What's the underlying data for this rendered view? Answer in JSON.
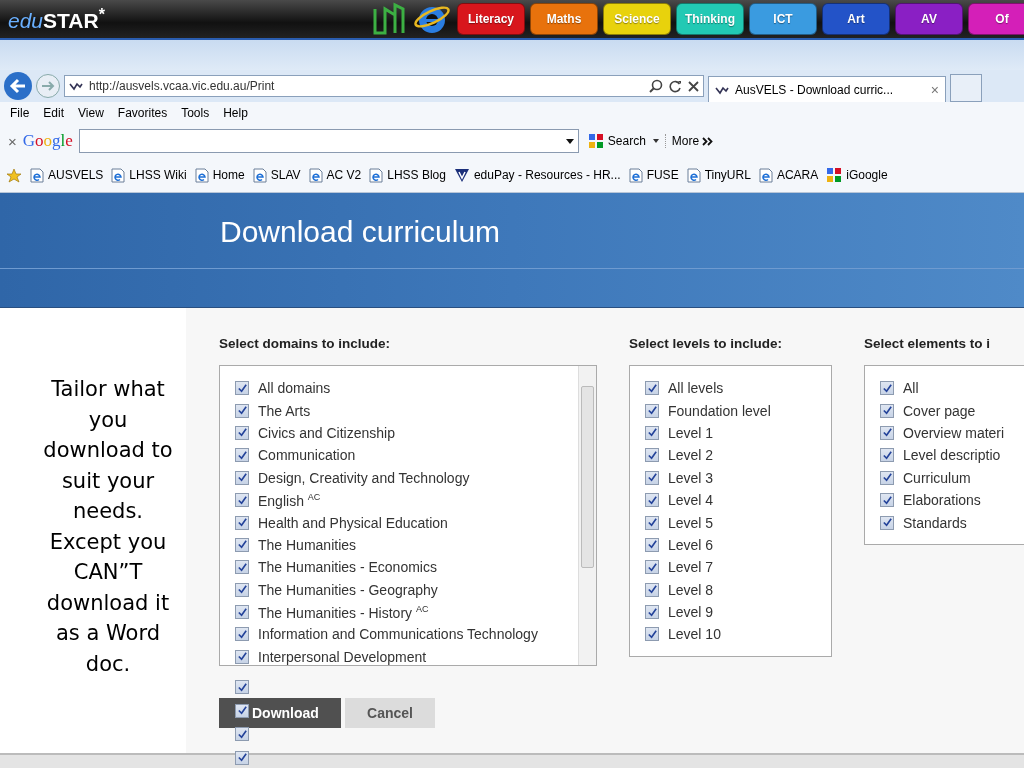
{
  "portal": {
    "logo": "eduSTAR",
    "logo_mark": "*",
    "tabs": [
      {
        "label": "Literacy",
        "color": "#d8161c"
      },
      {
        "label": "Maths",
        "color": "#e8720c"
      },
      {
        "label": "Science",
        "color": "#e8d20c"
      },
      {
        "label": "Thinking",
        "color": "#22c9b4"
      },
      {
        "label": "ICT",
        "color": "#3a9be0"
      },
      {
        "label": "Art",
        "color": "#2353c8"
      },
      {
        "label": "AV",
        "color": "#8a1fc4"
      },
      {
        "label": "Of",
        "color": "#d41fb8"
      }
    ]
  },
  "browser": {
    "address": "http://ausvels.vcaa.vic.edu.au/Print",
    "tab_title": "AusVELS - Download curric...",
    "tab_close": "×",
    "menu": [
      "File",
      "Edit",
      "View",
      "Favorites",
      "Tools",
      "Help"
    ],
    "google_toolbar": {
      "close": "×",
      "logo": "Google",
      "search": "Search",
      "more": "More"
    },
    "favorites": [
      {
        "label": "AUSVELS",
        "kind": "page"
      },
      {
        "label": "LHSS Wiki",
        "kind": "page"
      },
      {
        "label": "Home",
        "kind": "page"
      },
      {
        "label": "SLAV",
        "kind": "page"
      },
      {
        "label": "AC V2",
        "kind": "page"
      },
      {
        "label": "LHSS Blog",
        "kind": "page"
      },
      {
        "label": "eduPay - Resources - HR...",
        "kind": "shield"
      },
      {
        "label": "FUSE",
        "kind": "page"
      },
      {
        "label": "TinyURL",
        "kind": "page"
      },
      {
        "label": "ACARA",
        "kind": "page"
      },
      {
        "label": "iGoogle",
        "kind": "tiles"
      }
    ]
  },
  "page": {
    "title": "Download curriculum",
    "caption": "Tailor what you download to suit your needs. Except you CAN”T download it as a Word doc.",
    "domains": {
      "heading": "Select domains to include:",
      "items": [
        {
          "label": "All domains",
          "checked": true
        },
        {
          "label": "The Arts",
          "checked": true
        },
        {
          "label": "Civics and Citizenship",
          "checked": true
        },
        {
          "label": "Communication",
          "checked": true
        },
        {
          "label": "Design, Creativity and Technology",
          "checked": true
        },
        {
          "label": "English $^{AC}$",
          "checked": true
        },
        {
          "label": "Health and Physical Education",
          "checked": true
        },
        {
          "label": "The Humanities",
          "checked": true
        },
        {
          "label": "The Humanities - Economics",
          "checked": true
        },
        {
          "label": "The Humanities - Geography",
          "checked": true
        },
        {
          "label": "The Humanities - History $^{AC}$",
          "checked": true
        },
        {
          "label": "Information and Communications Technology",
          "checked": true
        },
        {
          "label": "Interpersonal Development",
          "checked": true
        }
      ]
    },
    "levels": {
      "heading": "Select levels to include:",
      "items": [
        {
          "label": "All levels",
          "checked": true
        },
        {
          "label": "Foundation level",
          "checked": true
        },
        {
          "label": "Level 1",
          "checked": true
        },
        {
          "label": "Level 2",
          "checked": true
        },
        {
          "label": "Level 3",
          "checked": true
        },
        {
          "label": "Level 4",
          "checked": true
        },
        {
          "label": "Level 5",
          "checked": true
        },
        {
          "label": "Level 6",
          "checked": true
        },
        {
          "label": "Level 7",
          "checked": true
        },
        {
          "label": "Level 8",
          "checked": true
        },
        {
          "label": "Level 9",
          "checked": true
        },
        {
          "label": "Level 10",
          "checked": true
        }
      ]
    },
    "elements": {
      "heading": "Select elements to i",
      "items": [
        {
          "label": "All",
          "checked": true
        },
        {
          "label": "Cover page",
          "checked": true
        },
        {
          "label": "Overview materi",
          "checked": true
        },
        {
          "label": "Level descriptio",
          "checked": true
        },
        {
          "label": "Curriculum",
          "checked": true
        },
        {
          "label": "Elaborations",
          "checked": true
        },
        {
          "label": "Standards",
          "checked": true
        }
      ]
    },
    "overflow_checkboxes": [
      {
        "checked": true
      },
      {
        "checked": true
      },
      {
        "checked": true
      },
      {
        "checked": true
      }
    ],
    "buttons": {
      "download": "Download",
      "cancel": "Cancel"
    }
  }
}
